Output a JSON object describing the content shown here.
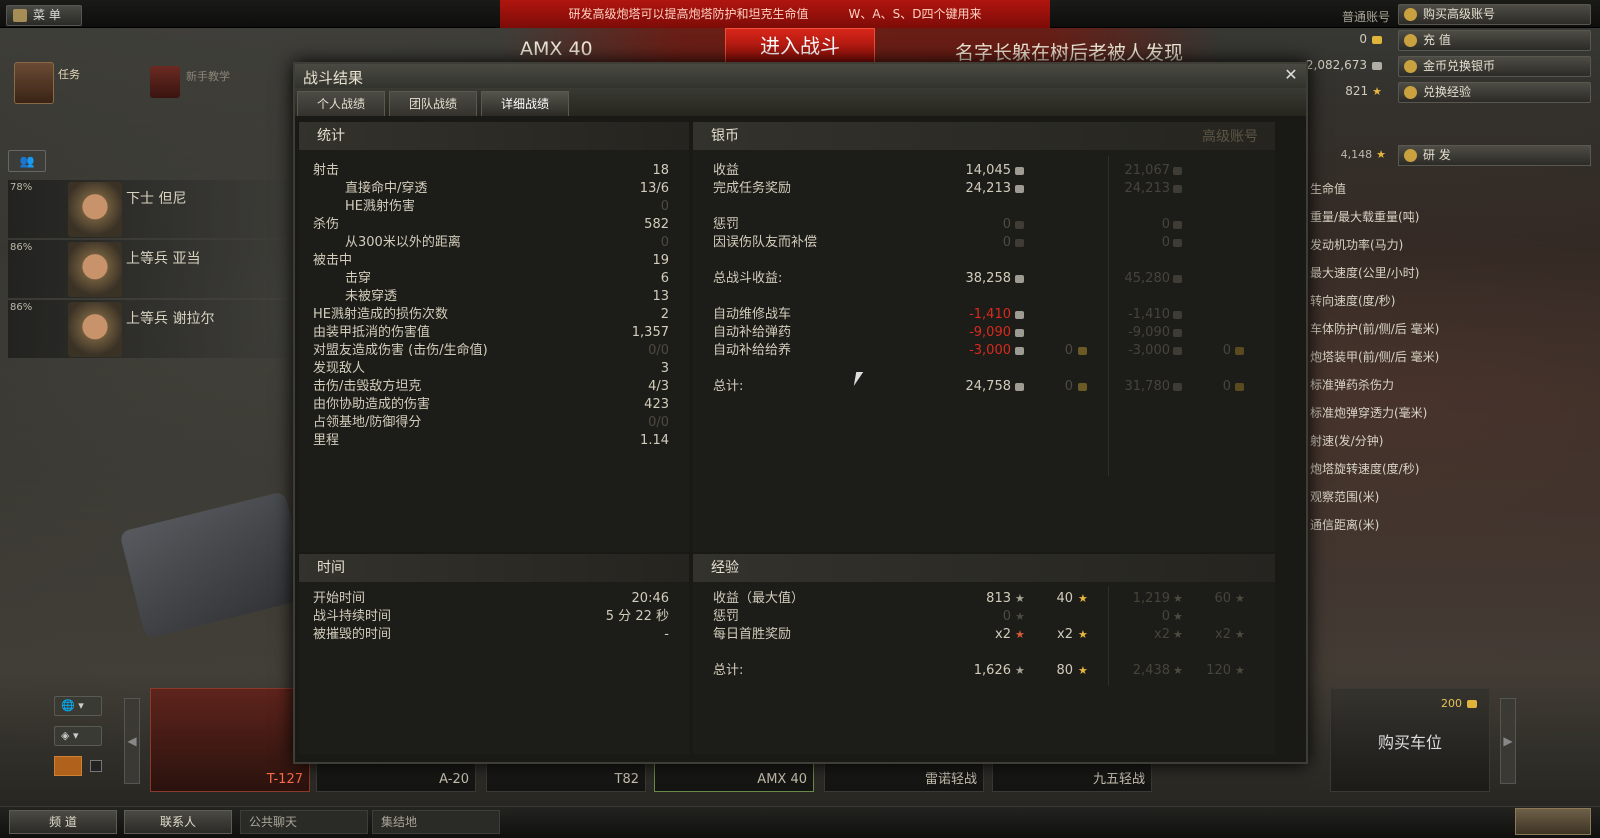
{
  "topbar": {
    "menu_label": "菜 单",
    "banner_left": "研发高级炮塔可以提高炮塔防护和坦克生命值",
    "banner_right": "W、A、S、D四个键用来",
    "tank_name": "AMX 40",
    "battle_button": "进入战斗",
    "player_name": "名字长躲在树后老被人发现"
  },
  "account": {
    "type_label": "普通账号",
    "buy_premium": "购买高级账号",
    "gold": "0",
    "recharge": "充 值",
    "silver": "2,082,673",
    "exchange_gold": "金币兑换银币",
    "free_xp": "821",
    "convert_xp": "兑换经验",
    "research_xp": "4,148",
    "research": "研 发"
  },
  "left": {
    "quest_label": "任务",
    "tutorial_label": "新手教学",
    "crew": [
      {
        "pct": "78%",
        "name": "下士 但尼"
      },
      {
        "pct": "86%",
        "name": "上等兵 亚当"
      },
      {
        "pct": "86%",
        "name": "上等兵 谢拉尔"
      }
    ]
  },
  "right_stats": [
    "生命值",
    "重量/最大载重量(吨)",
    "发动机功率(马力)",
    "最大速度(公里/小时)",
    "转向速度(度/秒)",
    "车体防护(前/侧/后 毫米)",
    "炮塔装甲(前/侧/后 毫米)",
    "标准弹药杀伤力",
    "标准炮弹穿透力(毫米)",
    "射速(发/分钟)",
    "炮塔旋转速度(度/秒)",
    "观察范围(米)",
    "通信距离(米)"
  ],
  "dialog": {
    "title": "战斗结果",
    "tabs": [
      "个人战绩",
      "团队战绩",
      "详细战绩"
    ],
    "stats": {
      "header": "统计",
      "rows": [
        {
          "label": "射击",
          "value": "18",
          "indent": false,
          "dim": false
        },
        {
          "label": "直接命中/穿透",
          "value": "13/6",
          "indent": true,
          "dim": false
        },
        {
          "label": "HE溅射伤害",
          "value": "0",
          "indent": true,
          "dim": true
        },
        {
          "label": "杀伤",
          "value": "582",
          "indent": false,
          "dim": false
        },
        {
          "label": "从300米以外的距离",
          "value": "0",
          "indent": true,
          "dim": true
        },
        {
          "label": "被击中",
          "value": "19",
          "indent": false,
          "dim": false
        },
        {
          "label": "击穿",
          "value": "6",
          "indent": true,
          "dim": false
        },
        {
          "label": "未被穿透",
          "value": "13",
          "indent": true,
          "dim": false
        },
        {
          "label": "HE溅射造成的损伤次数",
          "value": "2",
          "indent": false,
          "dim": false
        },
        {
          "label": "由装甲抵消的伤害值",
          "value": "1,357",
          "indent": false,
          "dim": false
        },
        {
          "label": "对盟友造成伤害 (击伤/生命值)",
          "value": "0/0",
          "indent": false,
          "dim": true
        },
        {
          "label": "发现敌人",
          "value": "3",
          "indent": false,
          "dim": false
        },
        {
          "label": "击伤/击毁敌方坦克",
          "value": "4/3",
          "indent": false,
          "dim": false
        },
        {
          "label": "由你协助造成的伤害",
          "value": "423",
          "indent": false,
          "dim": false
        },
        {
          "label": "占领基地/防御得分",
          "value": "0/0",
          "indent": false,
          "dim": true
        },
        {
          "label": "里程",
          "value": "1.14",
          "indent": false,
          "dim": false
        }
      ]
    },
    "credits": {
      "header": "银币",
      "premium_header": "高级账号",
      "rows": [
        {
          "label": "收益",
          "v1": "14,045",
          "v2": "",
          "p1": "21,067",
          "p2": "",
          "red": false,
          "dim": false
        },
        {
          "label": "完成任务奖励",
          "v1": "24,213",
          "v2": "",
          "p1": "24,213",
          "p2": "",
          "red": false,
          "dim": false
        },
        {
          "label": "惩罚",
          "v1": "0",
          "v2": "",
          "p1": "0",
          "p2": "",
          "red": false,
          "dim": true
        },
        {
          "label": "因误伤队友而补偿",
          "v1": "0",
          "v2": "",
          "p1": "0",
          "p2": "",
          "red": false,
          "dim": true
        },
        {
          "label": "总战斗收益:",
          "v1": "38,258",
          "v2": "",
          "p1": "45,280",
          "p2": "",
          "red": false,
          "dim": false
        },
        {
          "label": "自动维修战车",
          "v1": "-1,410",
          "v2": "",
          "p1": "-1,410",
          "p2": "",
          "red": true,
          "dim": false
        },
        {
          "label": "自动补给弹药",
          "v1": "-9,090",
          "v2": "",
          "p1": "-9,090",
          "p2": "",
          "red": true,
          "dim": false
        },
        {
          "label": "自动补给给养",
          "v1": "-3,000",
          "v2": "0",
          "p1": "-3,000",
          "p2": "0",
          "red": true,
          "dim": false
        },
        {
          "label": "总计:",
          "v1": "24,758",
          "v2": "0",
          "p1": "31,780",
          "p2": "0",
          "red": false,
          "dim": false
        }
      ]
    },
    "time": {
      "header": "时间",
      "rows": [
        {
          "label": "开始时间",
          "value": "20:46"
        },
        {
          "label": "战斗持续时间",
          "value": "5 分 22 秒"
        },
        {
          "label": "被摧毁的时间",
          "value": "-"
        }
      ]
    },
    "experience": {
      "header": "经验",
      "rows": [
        {
          "label": "收益（最大值）",
          "v1": "813",
          "v2": "40",
          "p1": "1,219",
          "p2": "60"
        },
        {
          "label": "惩罚",
          "v1": "0",
          "v2": "",
          "p1": "0",
          "p2": ""
        },
        {
          "label": "每日首胜奖励",
          "v1": "x2",
          "v2": "x2",
          "p1": "x2",
          "p2": "x2"
        },
        {
          "label": "总计:",
          "v1": "1,626",
          "v2": "80",
          "p1": "2,438",
          "p2": "120"
        }
      ]
    }
  },
  "carousel": {
    "slots": [
      "T-127",
      "A-20",
      "T82",
      "AMX 40",
      "雷诺轻战",
      "九五轻战"
    ],
    "buy_price": "200",
    "buy_label": "购买车位"
  },
  "bottom": {
    "channels": "频 道",
    "contacts": "联系人",
    "public_chat": "公共聊天",
    "rally": "集结地"
  }
}
